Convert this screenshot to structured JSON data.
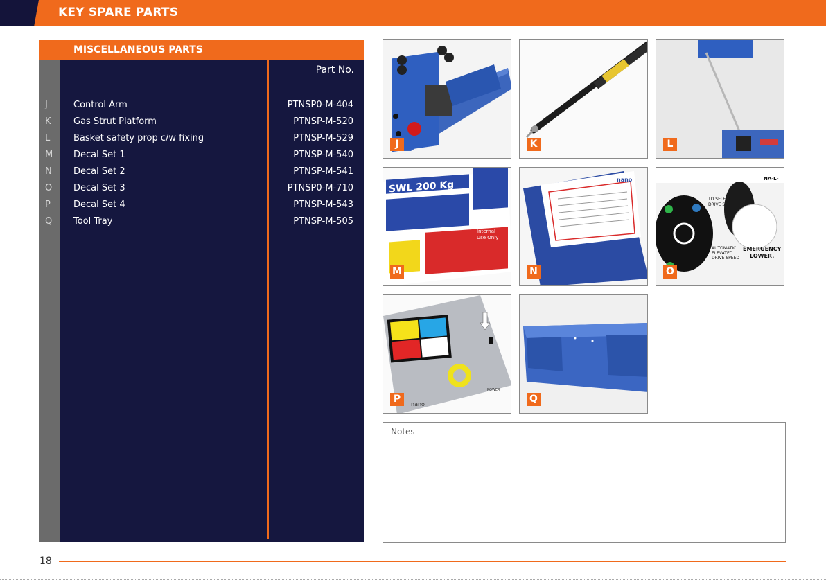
{
  "header": {
    "title": "KEY SPARE PARTS"
  },
  "table": {
    "title": "MISCELLANEOUS PARTS",
    "partno_header": "Part No.",
    "rows": [
      {
        "letter": "J",
        "name": "Control Arm",
        "part": "PTNSP0-M-404"
      },
      {
        "letter": "K",
        "name": "Gas Strut Platform",
        "part": "PTNSP-M-520"
      },
      {
        "letter": "L",
        "name": "Basket safety prop c/w fixing",
        "part": "PTNSP-M-529"
      },
      {
        "letter": "M",
        "name": "Decal Set 1",
        "part": "PTNSP-M-540"
      },
      {
        "letter": "N",
        "name": "Decal Set 2",
        "part": "PTNSP-M-541"
      },
      {
        "letter": "O",
        "name": "Decal Set 3",
        "part": "PTNSP0-M-710"
      },
      {
        "letter": "P",
        "name": "Decal Set 4",
        "part": "PTNSP-M-543"
      },
      {
        "letter": "Q",
        "name": "Tool Tray",
        "part": "PTNSP-M-505"
      }
    ]
  },
  "images": [
    {
      "label": "J",
      "depicts": "control-arm"
    },
    {
      "label": "K",
      "depicts": "gas-strut"
    },
    {
      "label": "L",
      "depicts": "safety-prop"
    },
    {
      "label": "M",
      "depicts": "decal-set-1"
    },
    {
      "label": "N",
      "depicts": "decal-set-2"
    },
    {
      "label": "O",
      "depicts": "decal-set-3"
    },
    {
      "label": "P",
      "depicts": "decal-set-4"
    },
    {
      "label": "Q",
      "depicts": "tool-tray"
    }
  ],
  "decal_text": {
    "swl": "SWL 200 Kg",
    "emergency": "EMERGENCY",
    "lower": "LOWER.",
    "to_select": "TO SELECT",
    "drive": "DRIVE S",
    "automatic": "AUTOMATIC",
    "elevated": "ELEVATED",
    "drive_speed": "DRIVE SPEED",
    "nal": "NA-L-",
    "internal": "Internal",
    "use_only": "Use Only",
    "power": "POWER",
    "brand": "nano"
  },
  "notes": {
    "label": "Notes"
  },
  "footer": {
    "page_number": "18"
  },
  "colors": {
    "accent": "#f06a1c",
    "navy": "#15173f",
    "gray": "#6b6b6b",
    "part_blue": "#2f5fc0"
  }
}
